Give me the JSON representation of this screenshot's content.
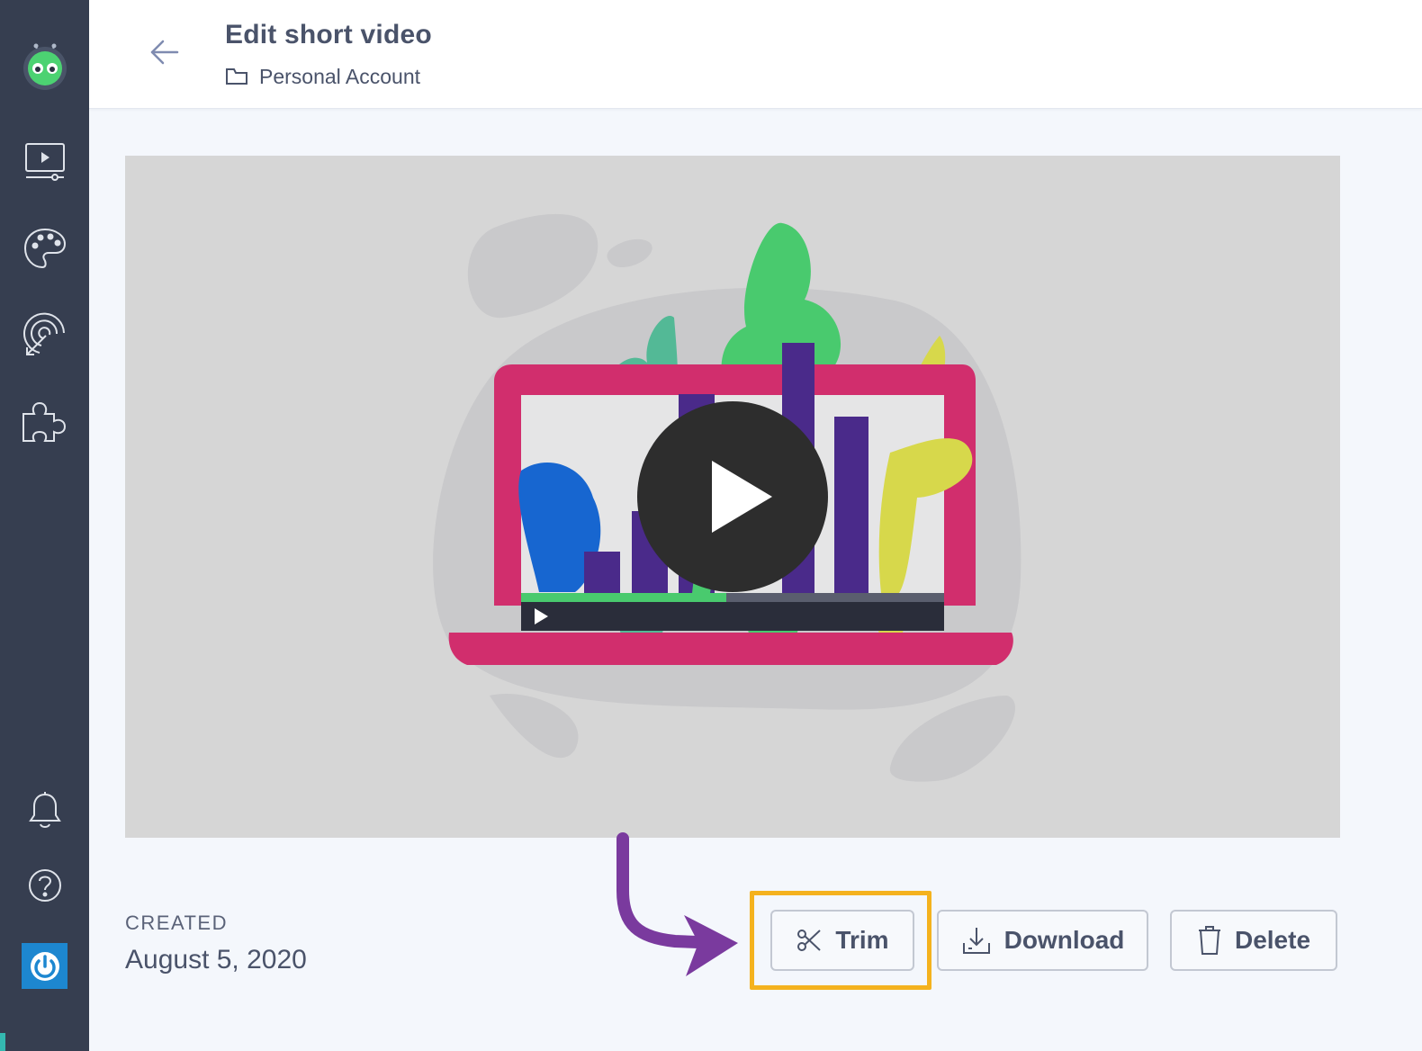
{
  "header": {
    "title": "Edit short video",
    "breadcrumb": "Personal Account"
  },
  "sidebar": {
    "items": [
      {
        "icon": "video-player-icon"
      },
      {
        "icon": "palette-icon"
      },
      {
        "icon": "target-icon"
      },
      {
        "icon": "puzzle-piece-icon"
      },
      {
        "icon": "bell-icon"
      },
      {
        "icon": "help-icon"
      },
      {
        "icon": "power-icon"
      }
    ]
  },
  "video": {
    "player_icon": "play-icon"
  },
  "meta": {
    "created_label": "CREATED",
    "created_date": "August 5, 2020"
  },
  "actions": {
    "trim_label": "Trim",
    "download_label": "Download",
    "delete_label": "Delete"
  },
  "colors": {
    "sidebar": "#363e50",
    "highlight": "#f4b21e",
    "arrow": "#7a3a9e",
    "power_button": "#1d87d0"
  }
}
